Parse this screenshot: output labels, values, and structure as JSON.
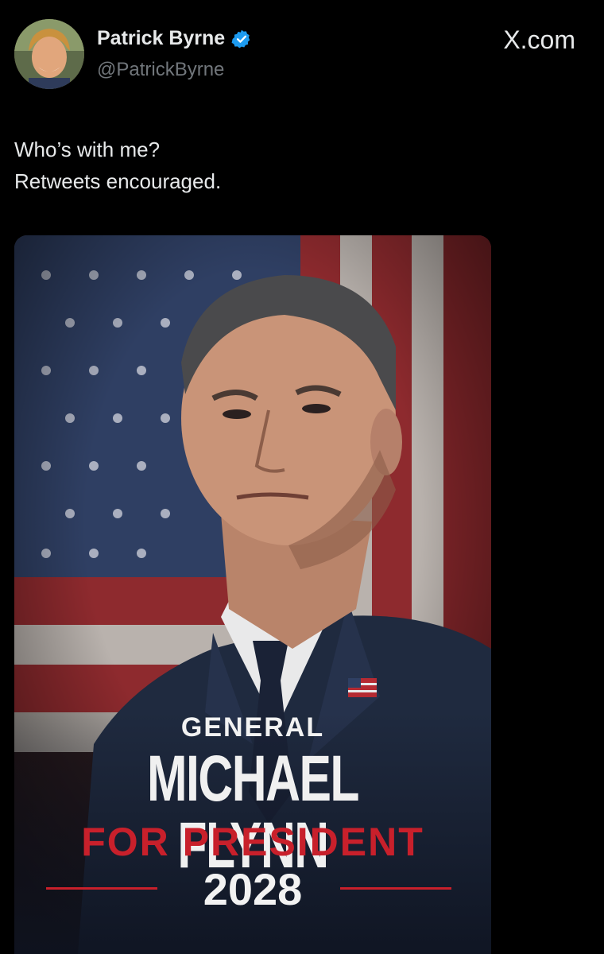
{
  "author": {
    "name": "Patrick Byrne",
    "handle": "@PatrickByrne",
    "verified_icon": "verified-badge-icon",
    "verified_color": "#1d9bf0"
  },
  "site_label": "X.com",
  "tweet": {
    "lines": [
      "Who’s with me?",
      "Retweets encouraged."
    ]
  },
  "poster": {
    "line1": "GENERAL",
    "line2": "MICHAEL FLYNN",
    "line3": "FOR PRESIDENT",
    "line4": "2028",
    "accent_color": "#c8202b"
  },
  "colors": {
    "background": "#000000",
    "text": "#e7e9ea",
    "secondary_text": "#71767b"
  }
}
